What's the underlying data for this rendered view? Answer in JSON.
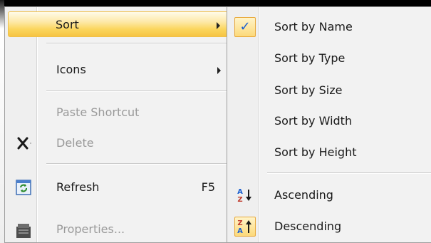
{
  "menu": {
    "items": [
      {
        "label": "Sort",
        "state": "highlighted",
        "submenu": true
      },
      {
        "label": "Icons",
        "submenu": true
      },
      {
        "label": "Paste Shortcut",
        "state": "disabled"
      },
      {
        "label": "Delete",
        "state": "disabled",
        "icon": "delete-x-icon"
      },
      {
        "label": "Refresh",
        "shortcut": "F5",
        "icon": "refresh-icon"
      },
      {
        "label": "Properties...",
        "state": "disabled",
        "icon": "properties-icon"
      }
    ]
  },
  "submenu": {
    "items": [
      {
        "label": "Sort by Name",
        "checked": true,
        "check_glyph": "✓"
      },
      {
        "label": "Sort by Type"
      },
      {
        "label": "Sort by Size"
      },
      {
        "label": "Sort by Width"
      },
      {
        "label": "Sort by Height"
      },
      {
        "label": "Ascending",
        "icon": "sort-ascending-icon",
        "icon_text": [
          "A",
          "Z"
        ]
      },
      {
        "label": "Descending",
        "icon": "sort-descending-icon",
        "icon_text": [
          "Z",
          "A"
        ],
        "active": true
      }
    ]
  },
  "colors": {
    "highlight": "#fbd65e",
    "check": "#1a5fd0",
    "disabled_text": "#9a9a9a",
    "refresh_icon": "#2a8a2a"
  }
}
